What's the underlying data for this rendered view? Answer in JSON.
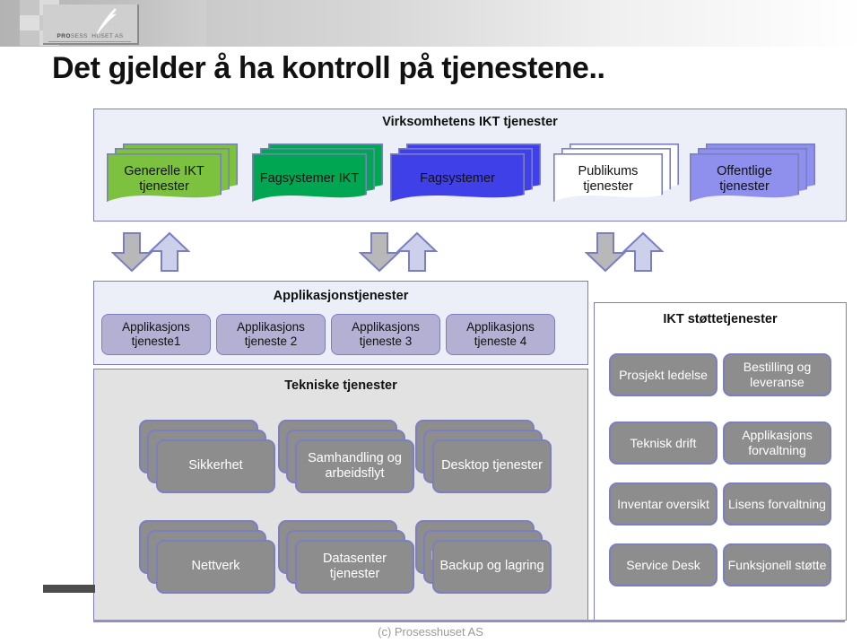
{
  "brand": {
    "logo_prefix": "PRO",
    "logo_rest": "SESS",
    "logo_suffix": "HUSET AS",
    "logo_icon": "up-arrow-icon"
  },
  "slide": {
    "title": "Det gjelder å ha kontroll på tjenestene..",
    "footer": "(c) Prosesshuset AS"
  },
  "top_panel": {
    "title": "Virksomhetens IKT tjenester",
    "items": [
      {
        "label": "Generelle IKT tjenester",
        "color": "#7dc23f"
      },
      {
        "label": "Fagsystemer IKT",
        "color": "#00a651"
      },
      {
        "label": "Fagsystemer",
        "color": "#4040e8"
      },
      {
        "label": "Publikums tjenester",
        "color": "#ffffff"
      },
      {
        "label": "Offentlige tjenester",
        "color": "#8f8fee"
      }
    ]
  },
  "arrows": {
    "down_color": "#b8b8b8",
    "up_color": "#ccd0ea",
    "pairs": 3
  },
  "app_panel": {
    "title": "Applikasjonstjenester",
    "boxes": [
      "Applikasjons tjeneste1",
      "Applikasjons tjeneste 2",
      "Applikasjons tjeneste 3",
      "Applikasjons tjeneste 4"
    ]
  },
  "tech_panel": {
    "title": "Tekniske tjenester",
    "cards": [
      "Sikkerhet",
      "Samhandling og arbeidsflyt",
      "Desktop tjenester",
      "Nettverk",
      "Datasenter tjenester",
      "Backup og lagring"
    ]
  },
  "support_panel": {
    "title": "IKT støttetjenester",
    "boxes": [
      "Prosjekt ledelse",
      "Bestilling og leveranse",
      "Teknisk drift",
      "Applikasjons forvaltning",
      "Inventar oversikt",
      "Lisens forvaltning",
      "Service Desk",
      "Funksjonell støtte"
    ]
  },
  "colors": {
    "accent_border": "#7b7fc0",
    "panel_light": "#eceff7",
    "panel_grey": "#e2e2e2",
    "card_grey": "#8d8d8d",
    "app_box": "#b3b0d4"
  }
}
